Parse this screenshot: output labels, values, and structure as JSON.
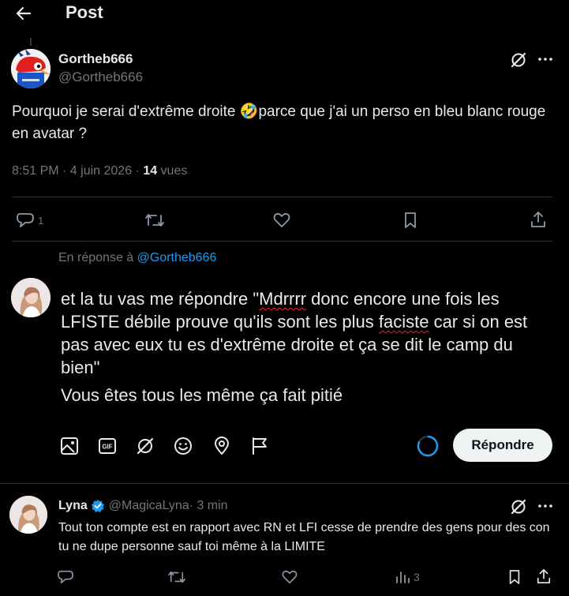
{
  "header": {
    "title": "Post"
  },
  "main_post": {
    "display_name": "Gortheb666",
    "handle": "@Gortheb666",
    "text_part1": "Pourquoi je serai d'extrême droite ",
    "emoji": "🤣",
    "text_part2": "parce que j'ai un perso en bleu blanc rouge en avatar ?",
    "time": "8:51 PM · 4 juin 2026 · ",
    "views_count": "14",
    "views_label": " vues",
    "reply_count": "1"
  },
  "composer": {
    "reply_to_prefix": "En réponse à ",
    "reply_to_handle": "@Gortheb666",
    "line1_a": "et la tu vas me répondre \"",
    "line1_b": "Mdrrrr",
    "line1_c": " donc encore une fois les LFISTE débile prouve qu'ils sont les plus ",
    "line1_d": "faciste",
    "line1_e": " car si on est pas avec eux tu es d'extrême droite et ça se dit le camp du bien\"",
    "line2": "Vous êtes tous les même ça fait pitié",
    "reply_button": "Répondre",
    "tool_icons": [
      "image-icon",
      "gif-icon",
      "grok-icon",
      "emoji-icon",
      "location-icon",
      "flag-icon"
    ]
  },
  "reply_post": {
    "display_name": "Lyna",
    "handle": "@MagicaLyna",
    "time": " · 3 min",
    "text": "Tout ton compte est en rapport avec RN et LFI cesse de prendre des gens pour des con tu ne dupe personne sauf toi même à la LIMITE",
    "views_count": "3"
  },
  "colors": {
    "background": "#000000",
    "text": "#e7e9ea",
    "muted": "#71767b",
    "link": "#1d9bf0",
    "divider": "#2f3336",
    "verified": "#1d9bf0"
  }
}
